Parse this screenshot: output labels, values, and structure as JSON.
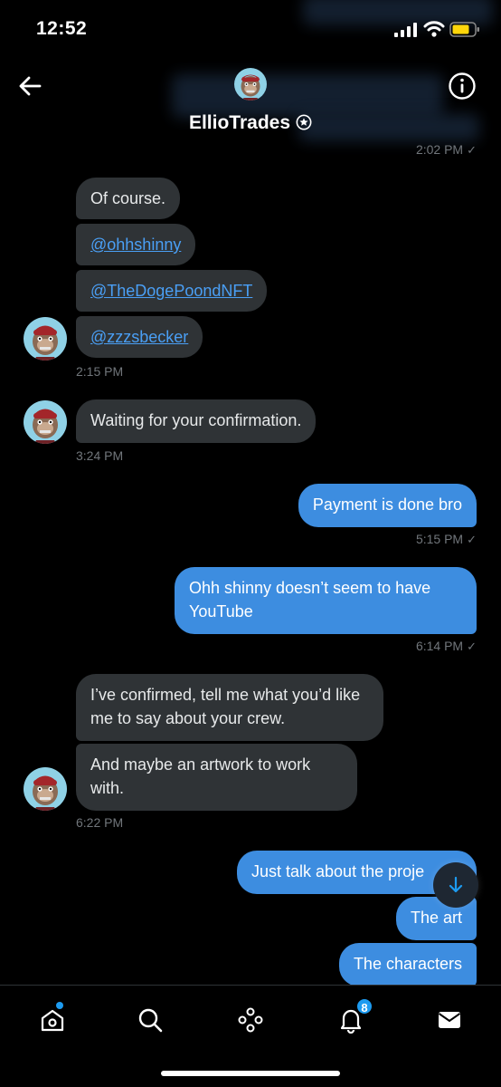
{
  "status_bar": {
    "time": "12:52"
  },
  "header": {
    "name": "EllioTrades"
  },
  "messages": {
    "ts_top": "2:02 PM",
    "group1": {
      "msg1": "Of course.",
      "link1": "@ohhshinny",
      "link2": "@TheDogePoondNFT",
      "link3": "@zzzsbecker",
      "time": "2:15 PM"
    },
    "group2": {
      "msg1": "Waiting for your confirmation.",
      "time": "3:24 PM"
    },
    "out1": {
      "msg1": "Payment is done bro",
      "time": "5:15 PM"
    },
    "out2": {
      "msg1": "Ohh shinny doesn’t seem to have YouTube",
      "time": "6:14 PM"
    },
    "group3": {
      "msg1": "I’ve confirmed, tell me what you’d like me to say about your crew.",
      "msg2": "And maybe an artwork to work with.",
      "time": "6:22 PM"
    },
    "out3": {
      "msg1": "Just talk about the proje",
      "msg2": "The art",
      "msg3": "The characters"
    }
  },
  "tab_bar": {
    "notifications_count": "8"
  },
  "icons": [
    "back-arrow-icon",
    "info-icon",
    "verified-icon",
    "chevron-down-icon",
    "home-icon",
    "search-icon",
    "spaces-icon",
    "bell-icon",
    "mail-icon"
  ],
  "colors": {
    "background": "#000000",
    "incoming_bubble": "#2f3336",
    "outgoing_bubble": "#3d8de0",
    "link": "#4a9ff5",
    "badge": "#1d9bf0"
  }
}
